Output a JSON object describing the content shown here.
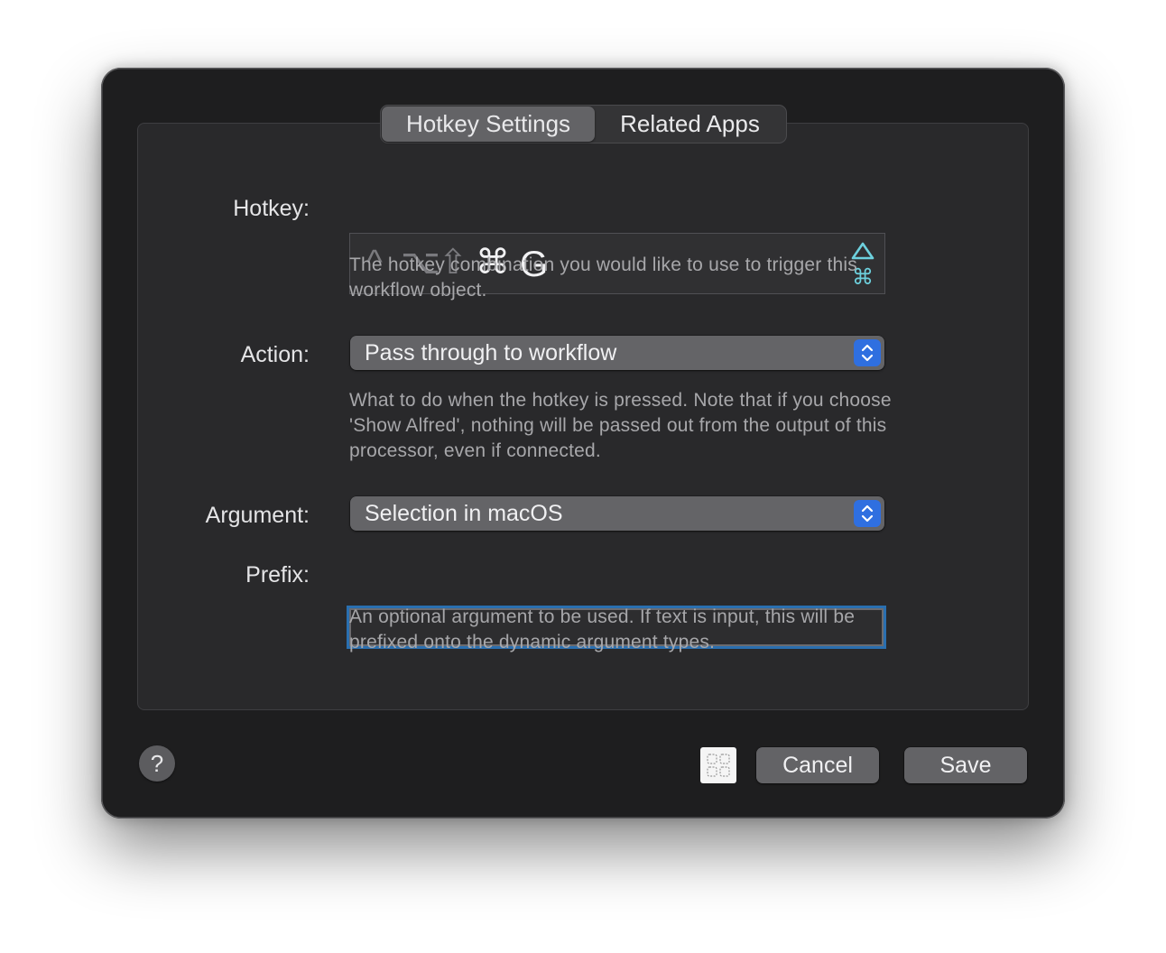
{
  "tabs": [
    {
      "label": "Hotkey Settings",
      "selected": true
    },
    {
      "label": "Related Apps",
      "selected": false
    }
  ],
  "hotkey": {
    "label": "Hotkey:",
    "modifiers": [
      {
        "symbol": "^",
        "name": "control",
        "active": false
      },
      {
        "symbol": "⌥",
        "name": "option",
        "active": false
      },
      {
        "symbol": "⇧",
        "name": "shift",
        "active": false
      },
      {
        "symbol": "⌘",
        "name": "command",
        "active": true
      }
    ],
    "key": "G",
    "indicator_icons": [
      "triangle-up-icon",
      "command-icon"
    ],
    "indicator_color": "#6dd0dd",
    "help": "The hotkey combination you would like to use to trigger this workflow object."
  },
  "action": {
    "label": "Action:",
    "value": "Pass through to workflow",
    "help": "What to do when the hotkey is pressed. Note that if you choose 'Show Alfred', nothing will be passed out from the output of this processor, even if connected."
  },
  "argument": {
    "label": "Argument:",
    "value": "Selection in macOS"
  },
  "prefix": {
    "label": "Prefix:",
    "value": "",
    "help": "An optional argument to be used. If text is input, this will be prefixed onto the dynamic argument types."
  },
  "footer": {
    "help_symbol": "?",
    "cancel_label": "Cancel",
    "save_label": "Save"
  },
  "colors": {
    "accent": "#2f6fe0",
    "focus_ring": "#2a6fb0",
    "window_bg": "#1e1e1f"
  }
}
